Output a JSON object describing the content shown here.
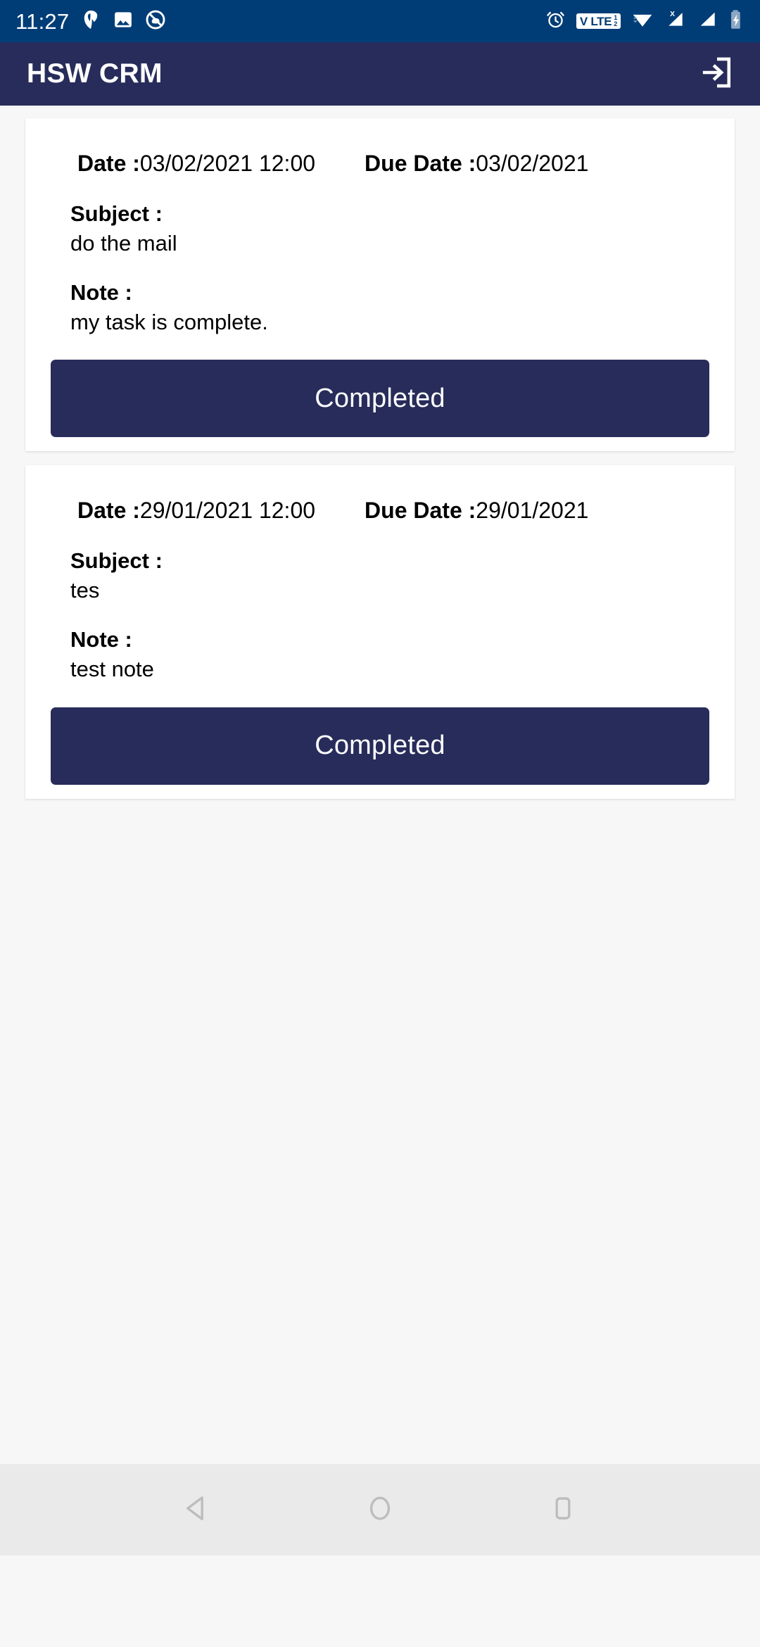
{
  "status_bar": {
    "time": "11:27",
    "background_color": "#003d77",
    "left_icons": [
      "app-notification-icon",
      "image-icon",
      "do-not-disturb-icon"
    ],
    "right_icons": [
      "alarm-icon",
      "volte-icon",
      "wifi-icon",
      "signal-no-sim-icon",
      "signal-icon",
      "battery-charging-icon"
    ],
    "volte_label": "V LTE",
    "volte_fraction_top": "1",
    "volte_fraction_bottom": "2"
  },
  "app_bar": {
    "title": "HSW CRM",
    "background_color": "#272c5a",
    "logout_icon": "logout-icon"
  },
  "theme": {
    "page_background": "#f7f7f7",
    "card_background": "#ffffff",
    "primary": "#272c5a",
    "button_text": "#ffffff",
    "text": "#000000"
  },
  "labels": {
    "date": "Date :",
    "due_date": "Due Date :",
    "subject": "Subject :",
    "note": "Note :"
  },
  "tasks": [
    {
      "date": "03/02/2021 12:00",
      "due_date": "03/02/2021",
      "subject": "do the mail",
      "note": "my task is complete.",
      "action_label": "Completed"
    },
    {
      "date": "29/01/2021 12:00",
      "due_date": "29/01/2021",
      "subject": "tes",
      "note": "test note",
      "action_label": "Completed"
    }
  ],
  "nav_bar": {
    "background_color": "#eaeaea",
    "buttons": [
      {
        "name": "back-button",
        "icon": "back-triangle-icon"
      },
      {
        "name": "home-button",
        "icon": "home-circle-icon"
      },
      {
        "name": "recents-button",
        "icon": "recents-square-icon"
      }
    ]
  }
}
